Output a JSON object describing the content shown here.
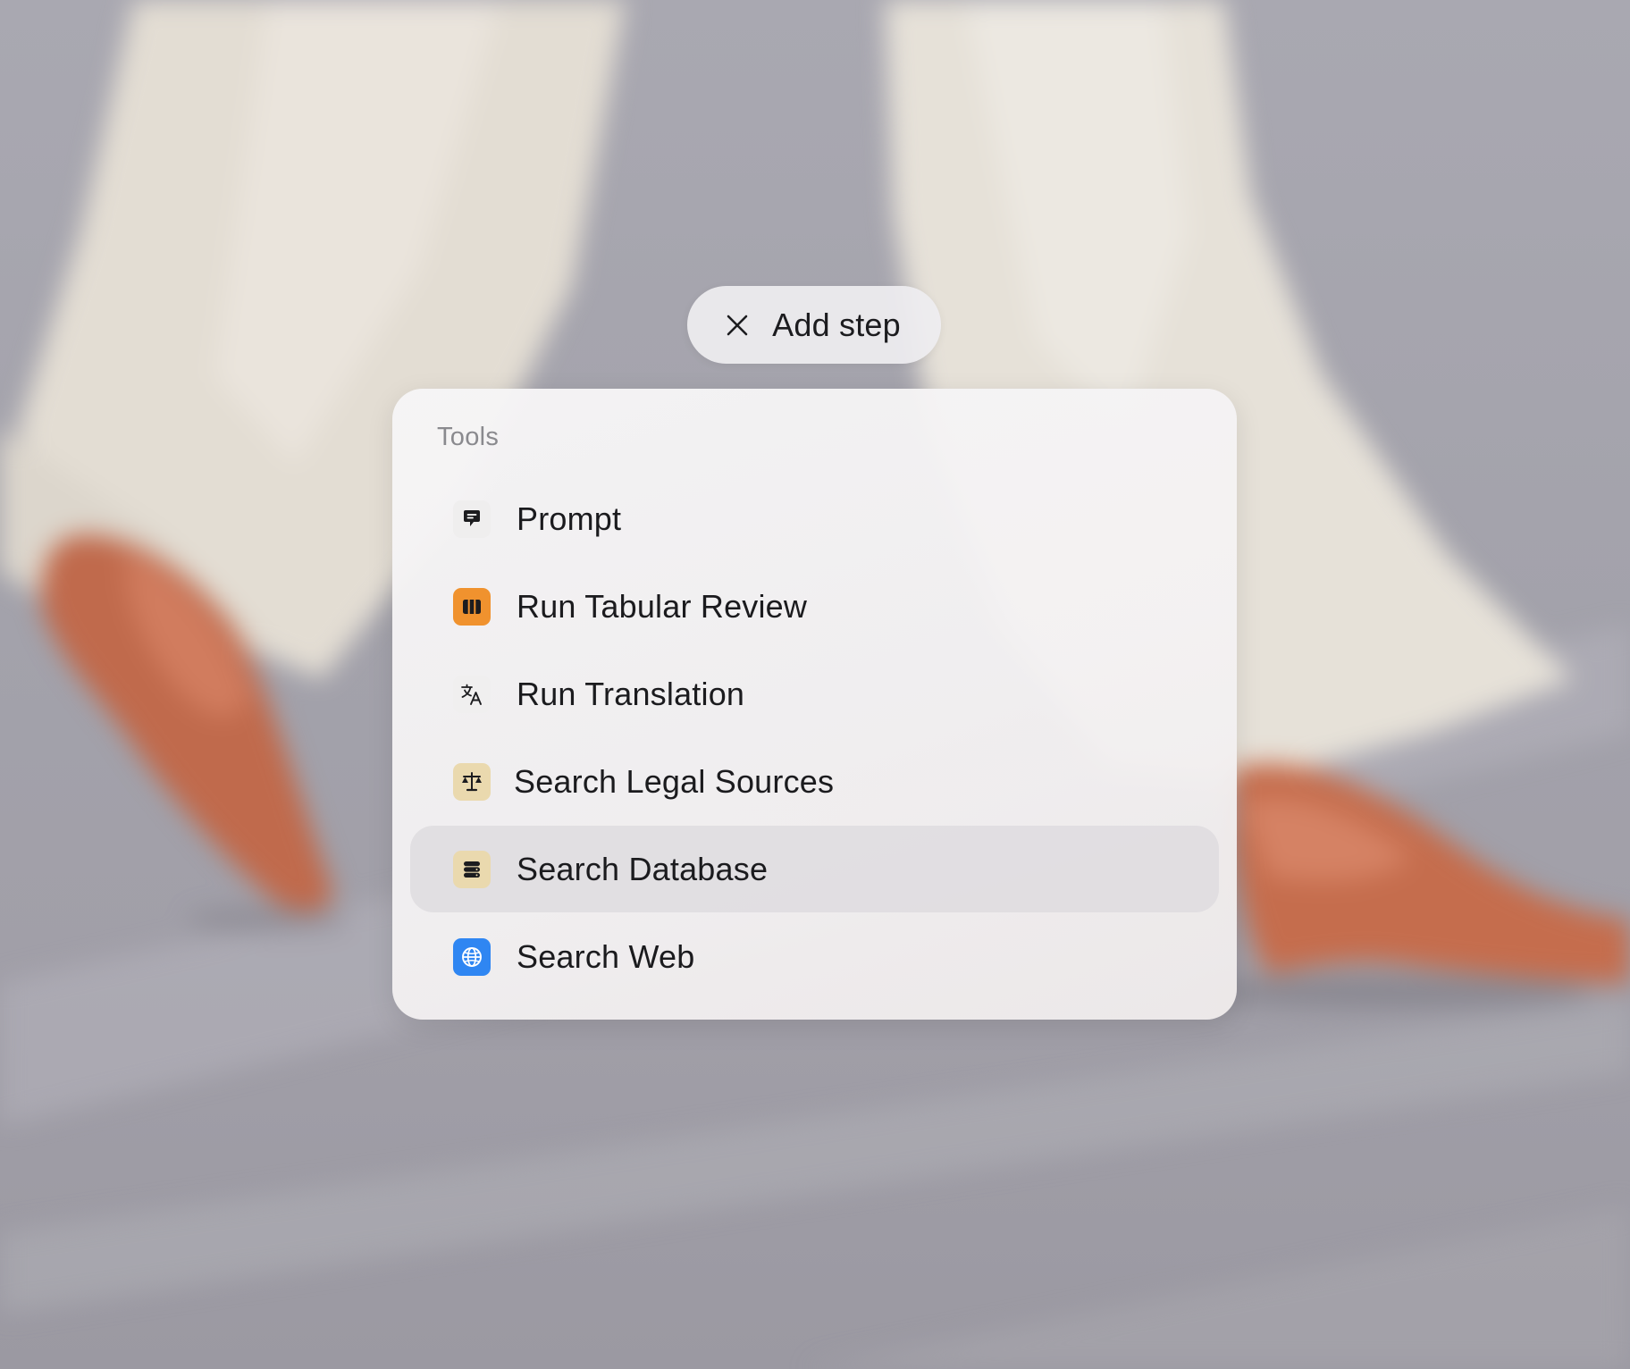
{
  "add_step": {
    "label": "Add step",
    "icon": "close-icon"
  },
  "tools_menu": {
    "section_title": "Tools",
    "items": [
      {
        "label": "Prompt",
        "icon": "speech-bubble-icon",
        "icon_color": "#1c1c1f",
        "selected": false
      },
      {
        "label": "Run Tabular Review",
        "icon": "columns-icon",
        "icon_color": "#f0922e",
        "selected": false
      },
      {
        "label": "Run Translation",
        "icon": "translate-icon",
        "icon_color": "#1c1c1f",
        "selected": false
      },
      {
        "label": "Search Legal Sources",
        "icon": "scales-icon",
        "icon_color": "#ead9ae",
        "selected": false
      },
      {
        "label": "Search Database",
        "icon": "database-icon",
        "icon_color": "#ead9ae",
        "selected": true
      },
      {
        "label": "Search Web",
        "icon": "globe-icon",
        "icon_color": "#2f86f2",
        "selected": false
      }
    ]
  }
}
